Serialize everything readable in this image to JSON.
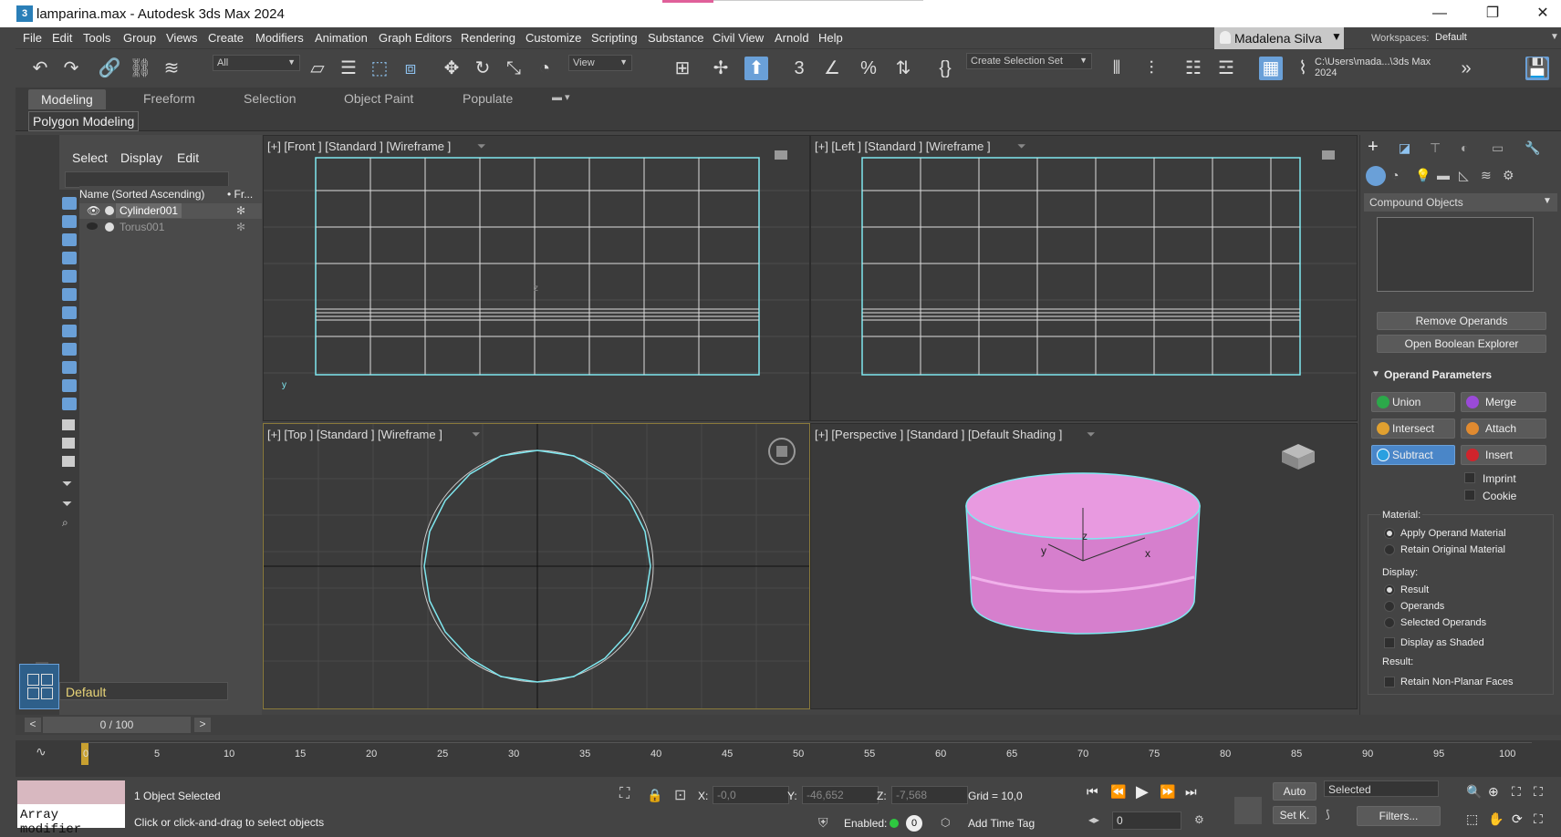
{
  "window": {
    "title": "lamparina.max - Autodesk 3ds Max 2024",
    "app_icon": "3",
    "minimize": "—",
    "restore": "❐",
    "close": "✕"
  },
  "menu": [
    "File",
    "Edit",
    "Tools",
    "Group",
    "Views",
    "Create",
    "Modifiers",
    "Animation",
    "Graph Editors",
    "Rendering",
    "Customize",
    "Scripting",
    "Substance",
    "Civil View",
    "Arnold",
    "Help"
  ],
  "user": {
    "name": "Madalena Silva"
  },
  "workspaces": {
    "label": "Workspaces:",
    "value": "Default"
  },
  "toolbar": {
    "filter_value": "All",
    "refcoord_value": "View",
    "selection_set_placeholder": "Create Selection Set",
    "snap_value": "3",
    "path_value": "C:\\Users\\mada...\\3ds Max 2024"
  },
  "ribbon": {
    "tabs": [
      "Modeling",
      "Freeform",
      "Selection",
      "Object Paint",
      "Populate"
    ],
    "active_tab": "Modeling",
    "panel_button": "Polygon Modeling"
  },
  "scene_explorer": {
    "tabs": [
      "Select",
      "Display",
      "Edit"
    ],
    "column_header": "Name (Sorted Ascending)",
    "column_header2": "• Fr...",
    "items": [
      {
        "name": "Cylinder001",
        "selected": true
      },
      {
        "name": "Torus001",
        "selected": false
      }
    ],
    "layer_value": "Default"
  },
  "viewports": {
    "front": "[+] [Front ]  [Standard ]  [Wireframe ]",
    "left": "[+] [Left ]  [Standard ]  [Wireframe ]",
    "top": "[+] [Top ]  [Standard ]  [Wireframe ]",
    "perspective": "[+] [Perspective ]  [Standard ]  [Default Shading ]",
    "axis_x": "x",
    "axis_y": "y",
    "axis_z": "z"
  },
  "command_panel": {
    "dropdown": "Compound Objects",
    "remove_operands": "Remove Operands",
    "open_boolean_explorer": "Open Boolean Explorer",
    "rollout_title": "Operand Parameters",
    "ops": {
      "union": "Union",
      "merge": "Merge",
      "intersect": "Intersect",
      "attach": "Attach",
      "subtract": "Subtract",
      "insert": "Insert",
      "imprint": "Imprint",
      "cookie": "Cookie"
    },
    "material_label": "Material:",
    "apply_operand_material": "Apply Operand Material",
    "retain_original_material": "Retain Original Material",
    "display_label": "Display:",
    "result": "Result",
    "operands": "Operands",
    "selected_operands": "Selected Operands",
    "display_as_shaded": "Display as Shaded",
    "result_label": "Result:",
    "retain_non_planar": "Retain Non-Planar Faces"
  },
  "time": {
    "frame_counter": "0 / 100",
    "prev": "<",
    "next": ">",
    "ticks": [
      "0",
      "5",
      "10",
      "15",
      "20",
      "25",
      "30",
      "35",
      "40",
      "45",
      "50",
      "55",
      "60",
      "65",
      "70",
      "75",
      "80",
      "85",
      "90",
      "95",
      "100"
    ]
  },
  "status": {
    "maxscript_text": "Array modifier",
    "selection": "1 Object Selected",
    "prompt": "Click or click-and-drag to select objects",
    "x_label": "X:",
    "x_value": "-0,0",
    "y_label": "Y:",
    "y_value": "-46,652",
    "z_label": "Z:",
    "z_value": "-7,568",
    "grid": "Grid = 10,0",
    "enabled": "Enabled:",
    "enabled_count": "0",
    "add_time_tag": "Add Time Tag",
    "auto": "Auto",
    "selected_value": "Selected",
    "set_key": "Set K.",
    "filters": "Filters...",
    "frame_value": "0"
  },
  "colors": {
    "accent": "#6aa0d8",
    "selection_wire": "#7fe8f0",
    "object_pink": "#e28ad8"
  }
}
